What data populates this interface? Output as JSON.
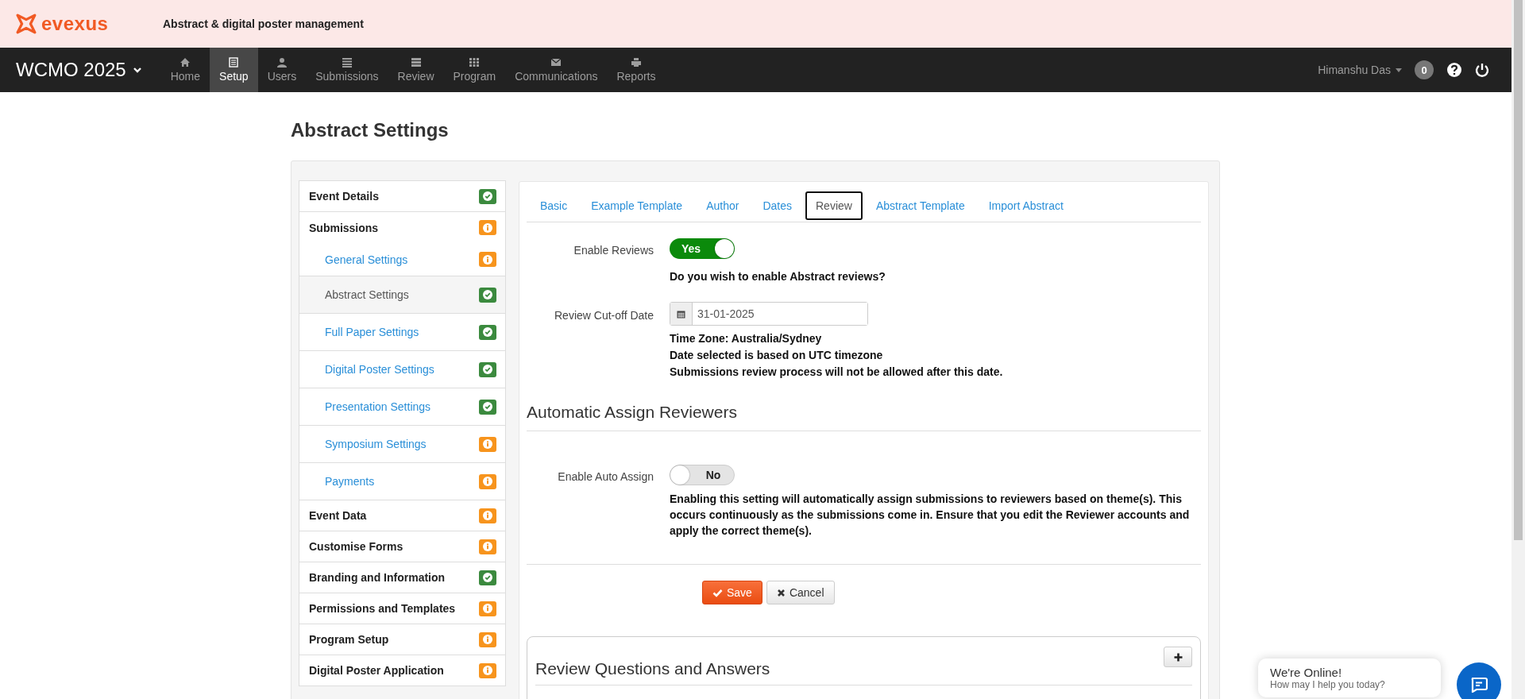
{
  "header": {
    "logo": "evexus",
    "tagline": "Abstract & digital poster management"
  },
  "nav": {
    "event": "WCMO 2025",
    "items": [
      {
        "label": "Home",
        "kind": "home",
        "selected": false
      },
      {
        "label": "Setup",
        "kind": "setup",
        "selected": true
      },
      {
        "label": "Users",
        "kind": "users",
        "selected": false
      },
      {
        "label": "Submissions",
        "kind": "submissions",
        "selected": false
      },
      {
        "label": "Review",
        "kind": "review",
        "selected": false
      },
      {
        "label": "Program",
        "kind": "program",
        "selected": false
      },
      {
        "label": "Communications",
        "kind": "communications",
        "selected": false
      },
      {
        "label": "Reports",
        "kind": "reports",
        "selected": false
      }
    ],
    "user": "Himanshu Das",
    "notifications": "0"
  },
  "page_title": "Abstract Settings",
  "sidebar": {
    "items": [
      {
        "label": "Event Details",
        "complete": true,
        "selected": false
      },
      {
        "label": "Submissions",
        "complete": false,
        "selected": false,
        "children": [
          {
            "label": "General Settings",
            "complete": false,
            "selected": false
          },
          {
            "label": "Abstract Settings",
            "complete": true,
            "selected": true
          },
          {
            "label": "Full Paper Settings",
            "complete": true,
            "selected": false
          },
          {
            "label": "Digital Poster Settings",
            "complete": true,
            "selected": false
          },
          {
            "label": "Presentation Settings",
            "complete": true,
            "selected": false
          },
          {
            "label": "Symposium Settings",
            "complete": false,
            "selected": false
          },
          {
            "label": "Payments",
            "complete": false,
            "selected": false
          }
        ]
      },
      {
        "label": "Event Data",
        "complete": false,
        "selected": false
      },
      {
        "label": "Customise Forms",
        "complete": false,
        "selected": false
      },
      {
        "label": "Branding and Information",
        "complete": true,
        "selected": false
      },
      {
        "label": "Permissions and Templates",
        "complete": false,
        "selected": false
      },
      {
        "label": "Program Setup",
        "complete": false,
        "selected": false
      },
      {
        "label": "Digital Poster Application",
        "complete": false,
        "selected": false
      }
    ]
  },
  "tabs": [
    {
      "label": "Basic",
      "selected": false
    },
    {
      "label": "Example Template",
      "selected": false
    },
    {
      "label": "Author",
      "selected": false
    },
    {
      "label": "Dates",
      "selected": false
    },
    {
      "label": "Review",
      "selected": true
    },
    {
      "label": "Abstract Template",
      "selected": false
    },
    {
      "label": "Import Abstract",
      "selected": false
    }
  ],
  "enable_reviews": {
    "label": "Enable Reviews",
    "on": true,
    "text": "Yes",
    "help": "Do you wish to enable Abstract reviews?"
  },
  "cutoff_date": {
    "label": "Review Cut-off Date",
    "value": "31-01-2025",
    "notes": [
      "Time Zone: Australia/Sydney",
      "Date selected is based on UTC timezone",
      "Submissions review process will not be allowed after this date."
    ]
  },
  "auto_assign": {
    "heading": "Automatic Assign Reviewers",
    "label": "Enable Auto Assign",
    "on": false,
    "text": "No",
    "help": "Enabling this setting will automatically assign submissions to reviewers based on theme(s). This occurs continuously as the submissions come in. Ensure that you edit the Reviewer accounts and apply the correct theme(s)."
  },
  "buttons": {
    "save": "Save",
    "cancel": "Cancel"
  },
  "questions_panel": {
    "title": "Review Questions and Answers"
  },
  "chat": {
    "title": "We're Online!",
    "subtitle": "How may I help you today?"
  }
}
